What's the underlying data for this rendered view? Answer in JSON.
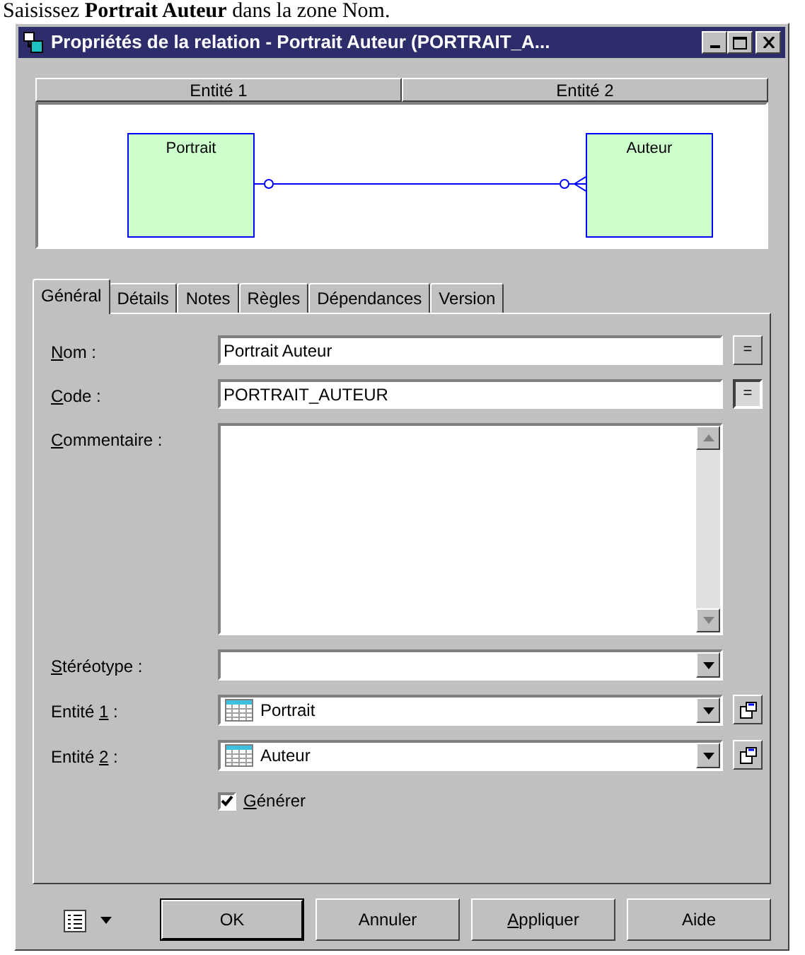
{
  "caption": "Saisissez **Portrait Auteur** dans la zone Nom.",
  "window": {
    "title": "Propriétés de la relation - Portrait Auteur (PORTRAIT_A..."
  },
  "entity_headers": [
    "Entité 1",
    "Entité 2"
  ],
  "diagram": {
    "entities": [
      {
        "name": "Portrait"
      },
      {
        "name": "Auteur"
      }
    ]
  },
  "tabs": [
    {
      "label": "Général",
      "selected": true
    },
    {
      "label": "Détails",
      "selected": false
    },
    {
      "label": "Notes",
      "selected": false
    },
    {
      "label": "Règles",
      "selected": false
    },
    {
      "label": "Dépendances",
      "selected": false
    },
    {
      "label": "Version",
      "selected": false
    }
  ],
  "fields": [
    {
      "kind": "text",
      "label": {
        "key": "N",
        "post": "om :"
      },
      "value": "Portrait Auteur",
      "button": "=",
      "pressed": false
    },
    {
      "kind": "text",
      "label": {
        "key": "C",
        "post": "ode :"
      },
      "value": "PORTRAIT_AUTEUR",
      "button": "=",
      "pressed": true
    },
    {
      "kind": "memo",
      "label": {
        "key": "C",
        "post": "ommentaire :"
      }
    },
    {
      "kind": "combo",
      "label": {
        "key": "S",
        "post": "téréotype :"
      }
    },
    {
      "kind": "entity",
      "label": {
        "pre": "Entité ",
        "key": "1",
        "post": " :"
      },
      "value": "Portrait"
    },
    {
      "kind": "entity",
      "label": {
        "pre": "Entité ",
        "key": "2",
        "post": " :"
      },
      "value": "Auteur"
    }
  ],
  "generate": {
    "label": {
      "key": "G",
      "post": "énérer"
    },
    "checked": true
  },
  "buttons": [
    {
      "label": {
        "pre": "OK"
      },
      "default": true
    },
    {
      "label": {
        "pre": "Annuler"
      },
      "default": false
    },
    {
      "label": {
        "key": "A",
        "post": "ppliquer"
      },
      "default": false
    },
    {
      "label": {
        "pre": "Aide"
      },
      "default": false
    }
  ]
}
